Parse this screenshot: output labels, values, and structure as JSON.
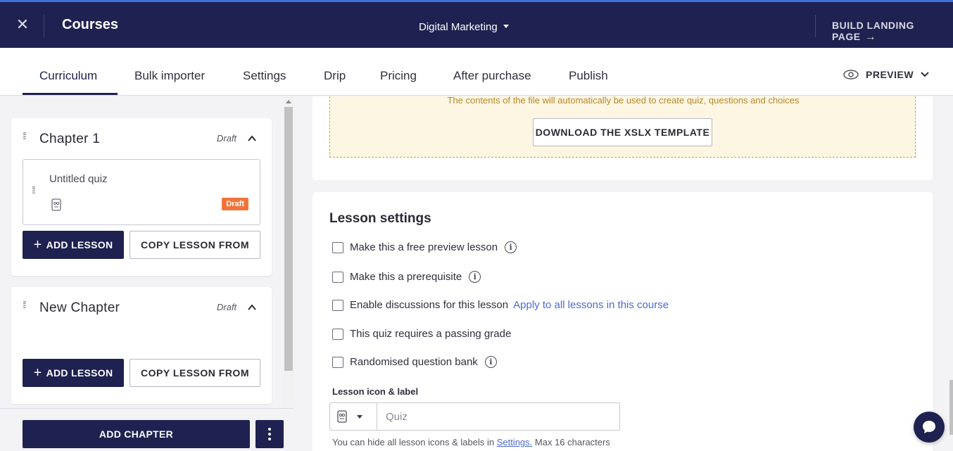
{
  "header": {
    "title": "Courses",
    "course_name": "Digital Marketing",
    "build_landing_label": "BUILD LANDING PAGE"
  },
  "tabs": [
    {
      "label": "Curriculum",
      "active": true
    },
    {
      "label": "Bulk importer"
    },
    {
      "label": "Settings"
    },
    {
      "label": "Drip"
    },
    {
      "label": "Pricing"
    },
    {
      "label": "After purchase"
    },
    {
      "label": "Publish"
    }
  ],
  "preview_label": "PREVIEW",
  "chapters": [
    {
      "title": "Chapter 1",
      "status": "Draft",
      "lessons": [
        {
          "name": "Untitled quiz",
          "badge": "Draft"
        }
      ],
      "add_lesson_label": "ADD LESSON",
      "copy_lesson_label": "COPY LESSON FROM"
    },
    {
      "title": "New Chapter",
      "status": "Draft",
      "lessons": [],
      "add_lesson_label": "ADD LESSON",
      "copy_lesson_label": "COPY LESSON FROM"
    }
  ],
  "add_chapter_label": "ADD CHAPTER",
  "import": {
    "note": "The contents of the file will automatically be used to create quiz, questions and choices",
    "download_label": "DOWNLOAD THE XSLX TEMPLATE"
  },
  "lesson_settings": {
    "title": "Lesson settings",
    "options": [
      {
        "label": "Make this a free preview lesson",
        "info": true,
        "checked": false
      },
      {
        "label": "Make this a prerequisite",
        "info": true,
        "checked": false
      },
      {
        "label": "Enable discussions for this lesson",
        "link": "Apply to all lessons in this course",
        "checked": false
      },
      {
        "label": "This quiz requires a passing grade",
        "checked": false
      },
      {
        "label": "Randomised question bank",
        "info": true,
        "checked": false
      }
    ],
    "icon_label_title": "Lesson icon & label",
    "label_placeholder": "Quiz",
    "hint_prefix": "You can hide all lesson icons & labels in",
    "hint_link": "Settings.",
    "hint_suffix": "Max 16 characters"
  },
  "colors": {
    "navy": "#1f2150",
    "draft_badge": "#f0743a",
    "link": "#4b6bd0",
    "dropzone_bg": "#fdf6e2"
  }
}
